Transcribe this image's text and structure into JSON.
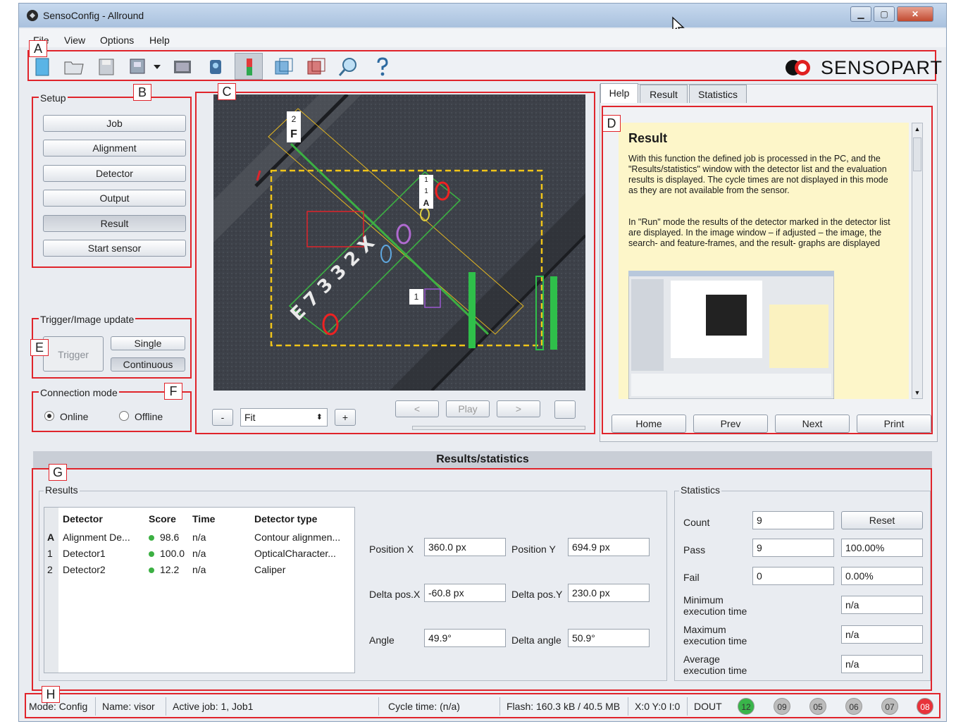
{
  "window": {
    "title": "SensoConfig - Allround",
    "controls": [
      "▁",
      "▢",
      "✕"
    ]
  },
  "menu": {
    "items": [
      "File",
      "View",
      "Options",
      "Help"
    ]
  },
  "toolbar": {
    "logo_text": "SENSOPART",
    "icons": [
      "new-job-icon",
      "open-icon",
      "save-icon",
      "save-to-sensor-icon",
      "dropdown-arrow-icon",
      "film-strip-icon",
      "sensor-icon",
      "run-mode-icon",
      "image-sequence-icon",
      "image-compare-icon",
      "zoom-icon",
      "help-icon"
    ]
  },
  "markers": {
    "A": "A",
    "B": "B",
    "C": "C",
    "D": "D",
    "E": "E",
    "F": "F",
    "G": "G",
    "H": "H"
  },
  "setup": {
    "title": "Setup",
    "buttons": [
      "Job",
      "Alignment",
      "Detector",
      "Output",
      "Result",
      "Start sensor"
    ],
    "active": "Result"
  },
  "trigger": {
    "title": "Trigger/Image update",
    "trigger_label": "Trigger",
    "single_label": "Single",
    "continuous_label": "Continuous"
  },
  "connection": {
    "title": "Connection mode",
    "online_label": "Online",
    "offline_label": "Offline",
    "selected": "Online"
  },
  "image_view": {
    "overlay_labels": {
      "box2": "2",
      "box_f": "F",
      "box1_top": "1",
      "box1_bottom": "1",
      "box_a": "A",
      "box1_right": "1"
    },
    "zoom_minus": "-",
    "zoom_value": "Fit",
    "zoom_plus": "+",
    "prev_label": "<",
    "play_label": "Play",
    "next_label": ">"
  },
  "help_panel": {
    "tabs": [
      "Help",
      "Result",
      "Statistics"
    ],
    "active_tab": "Help",
    "heading": "Result",
    "paragraph1": "With this function the defined job is processed in the PC, and the \"Results/statistics\" window with the detector list and the evaluation results is displayed. The cycle times are not displayed in this mode as they are not available from the sensor.",
    "paragraph2": "In \"Run\" mode the results of the detector marked in the detector list are displayed. In the image window – if adjusted – the image, the search- and feature-frames, and the result- graphs are displayed",
    "nav_buttons": [
      "Home",
      "Prev",
      "Next",
      "Print"
    ]
  },
  "results_stats": {
    "header": "Results/statistics",
    "results_title": "Results",
    "columns": [
      "Detector",
      "Score",
      "Time",
      "Detector type"
    ],
    "rows": [
      {
        "id": "A",
        "detector": "Alignment De...",
        "status_color": "#3cb043",
        "score": "98.6",
        "time": "n/a",
        "type": "Contour alignmen..."
      },
      {
        "id": "1",
        "detector": "Detector1",
        "status_color": "#3cb043",
        "score": "100.0",
        "time": "n/a",
        "type": "OpticalCharacter..."
      },
      {
        "id": "2",
        "detector": "Detector2",
        "status_color": "#3cb043",
        "score": "12.2",
        "time": "n/a",
        "type": "Caliper"
      }
    ],
    "position_x_label": "Position X",
    "position_x": "360.0 px",
    "position_y_label": "Position Y",
    "position_y": "694.9 px",
    "delta_x_label": "Delta pos.X",
    "delta_x": "-60.8 px",
    "delta_y_label": "Delta pos.Y",
    "delta_y": "230.0 px",
    "angle_label": "Angle",
    "angle": "49.9°",
    "delta_angle_label": "Delta angle",
    "delta_angle": "50.9°",
    "stats_title": "Statistics",
    "count_label": "Count",
    "count": "9",
    "reset_label": "Reset",
    "pass_label": "Pass",
    "pass": "9",
    "pass_pct": "100.00%",
    "fail_label": "Fail",
    "fail": "0",
    "fail_pct": "0.00%",
    "min_label_1": "Minimum",
    "min_label_2": "execution time",
    "min_value": "n/a",
    "max_label_1": "Maximum",
    "max_label_2": "execution time",
    "max_value": "n/a",
    "avg_label_1": "Average",
    "avg_label_2": "execution time",
    "avg_value": "n/a"
  },
  "status_bar": {
    "mode": "Mode:   Config",
    "name": "Name:   visor",
    "active_job": "Active job:   1, Job1",
    "cycle_time": "Cycle time:   (n/a)",
    "flash": "Flash:   160.3 kB / 40.5 MB",
    "xyi": "X:0 Y:0 I:0",
    "dout_label": "DOUT",
    "leds": [
      {
        "label": "12",
        "color": "#39b54a"
      },
      {
        "label": "09",
        "color": "#b9b9b9"
      },
      {
        "label": "05",
        "color": "#b9b9b9"
      },
      {
        "label": "06",
        "color": "#b9b9b9"
      },
      {
        "label": "07",
        "color": "#b9b9b9"
      },
      {
        "label": "08",
        "color": "#e8333a"
      }
    ]
  }
}
